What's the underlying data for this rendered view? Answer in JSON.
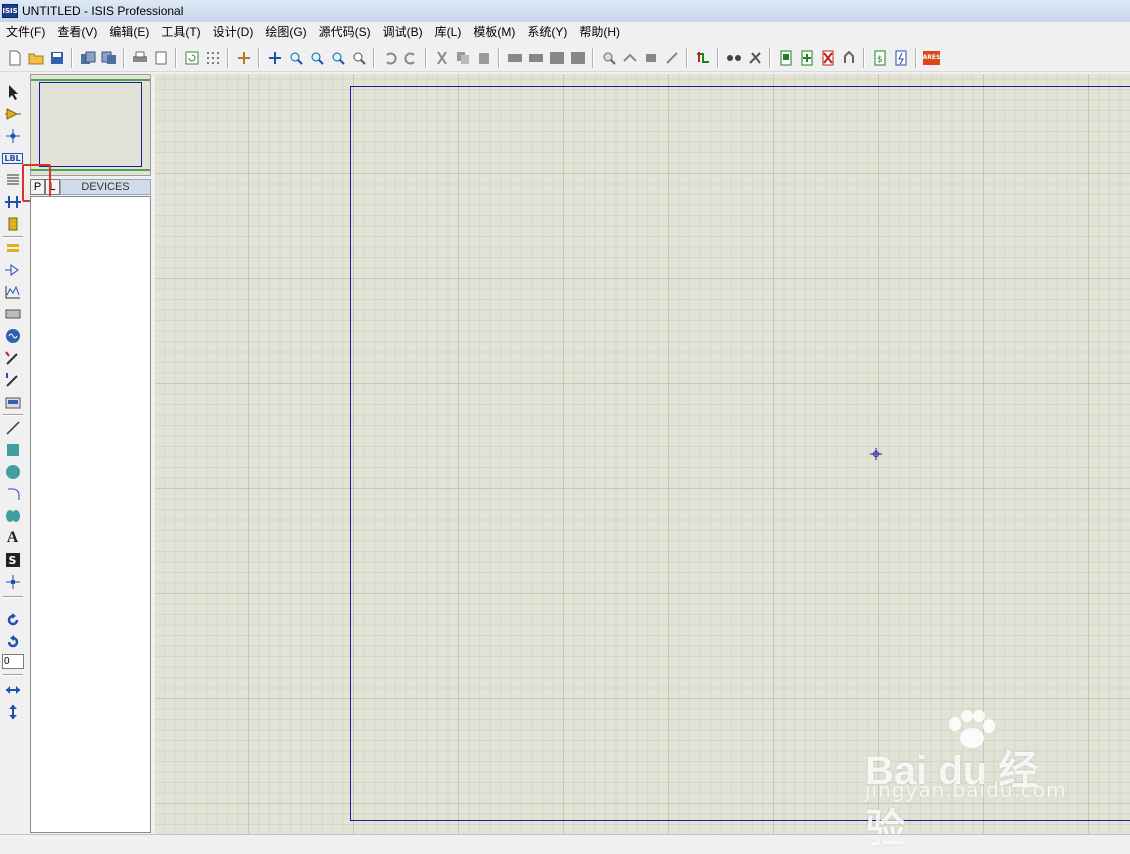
{
  "window": {
    "title": "UNTITLED - ISIS Professional",
    "logo_text": "ISIS"
  },
  "menu": [
    {
      "label": "文件(F)"
    },
    {
      "label": "查看(V)"
    },
    {
      "label": "编辑(E)"
    },
    {
      "label": "工具(T)"
    },
    {
      "label": "设计(D)"
    },
    {
      "label": "绘图(G)"
    },
    {
      "label": "源代码(S)"
    },
    {
      "label": "调试(B)"
    },
    {
      "label": "库(L)"
    },
    {
      "label": "模板(M)"
    },
    {
      "label": "系统(Y)"
    },
    {
      "label": "帮助(H)"
    }
  ],
  "toolbar": {
    "icons": [
      "new-file-icon",
      "open-folder-icon",
      "save-icon",
      "import-section-icon",
      "export-section-icon",
      "print-icon",
      "print-area-icon",
      "refresh-icon",
      "grid-icon",
      "origin-icon",
      "pan-icon",
      "zoom-in-icon",
      "zoom-out-icon",
      "zoom-all-icon",
      "zoom-area-icon",
      "undo-icon",
      "redo-icon",
      "cut-icon",
      "copy-icon",
      "paste-icon",
      "block-copy-icon",
      "block-move-icon",
      "block-rotate-icon",
      "block-delete-icon",
      "pick-device-icon",
      "make-device-icon",
      "packaging-tool-icon",
      "decompose-icon",
      "wire-autorouter-icon",
      "search-tag-icon",
      "property-assignment-icon",
      "new-sheet-icon",
      "add-sheet-icon",
      "remove-sheet-icon",
      "goto-child-icon",
      "bill-of-materials-icon",
      "electrical-rules-icon",
      "ares-netlist-icon"
    ],
    "ares_label": "ARES"
  },
  "left_tools": {
    "label_icon_text": "LBL",
    "rotation_value": "0",
    "text_tool_glyph": "A",
    "symbol_tool_glyph": "S"
  },
  "object_selector": {
    "pick_button": "P",
    "library_button": "L",
    "header": "DEVICES",
    "items": []
  },
  "watermark": {
    "logo": "Bai du 经验",
    "url": "jingyan.baidu.com"
  },
  "colors": {
    "canvas": "#e2e2d6",
    "sheet_border": "#1a1a9e",
    "highlight": "#e0302a",
    "devices_header": "#d0dcea"
  }
}
